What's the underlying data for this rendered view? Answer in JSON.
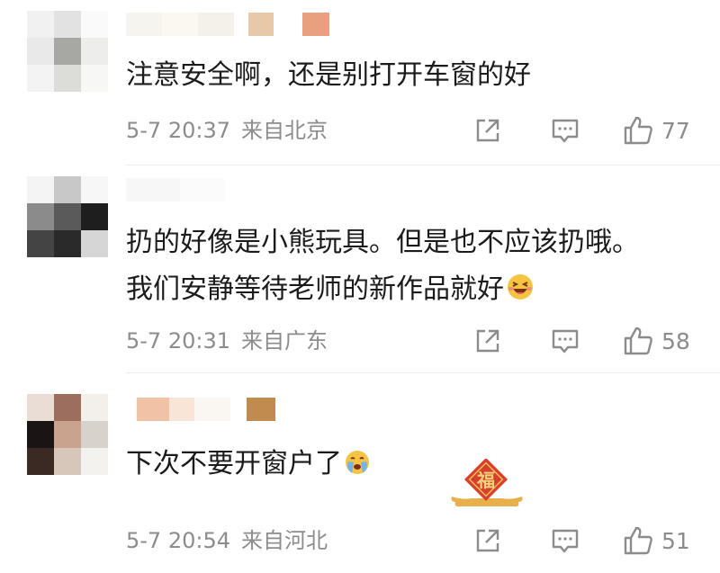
{
  "comments": [
    {
      "text": "注意安全啊，还是别打开车窗的好",
      "time": "5-7 20:37",
      "location": "来自北京",
      "likes": "77"
    },
    {
      "text_line1": "扔的好像是小熊玩具。但是也不应该扔哦。",
      "text_line2": "我们安静等待老师的新作品就好",
      "emoji": "laughing-face-emoji",
      "time": "5-7 20:31",
      "location": "来自广东",
      "likes": "58"
    },
    {
      "text": "下次不要开窗户了",
      "emoji": "crying-face-emoji",
      "badge": "福",
      "time": "5-7 20:54",
      "location": "来自河北",
      "likes": "51"
    }
  ],
  "icons": {
    "share": "share-icon",
    "comment": "comment-icon",
    "like": "thumbs-up-icon"
  },
  "colors": {
    "meta_text": "#8c8c8c",
    "badge_red": "#d7402a",
    "badge_gold": "#e8b04a"
  }
}
